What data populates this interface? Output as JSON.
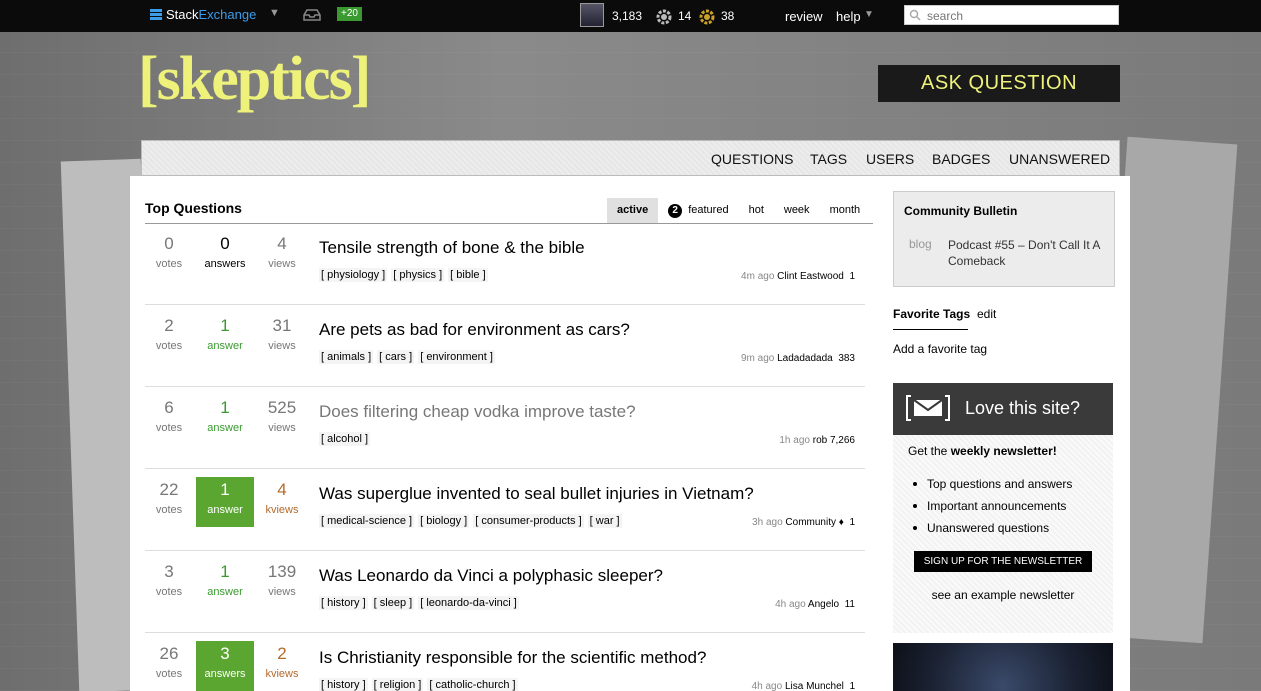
{
  "topbar": {
    "brand_part1": "Stack",
    "brand_part2": "Exchange",
    "rep_change": "+20",
    "reputation": "3,183",
    "silver_badges": "14",
    "bronze_badges": "38",
    "review": "review",
    "help": "help",
    "search_placeholder": "search"
  },
  "header": {
    "logo": "[skeptics]",
    "ask_button": "ASK QUESTION"
  },
  "nav": [
    "QUESTIONS",
    "TAGS",
    "USERS",
    "BADGES",
    "UNANSWERED"
  ],
  "main": {
    "title": "Top Questions",
    "tabs": [
      {
        "label": "active"
      },
      {
        "label": "featured",
        "count": "2"
      },
      {
        "label": "hot"
      },
      {
        "label": "week"
      },
      {
        "label": "month"
      }
    ],
    "questions": [
      {
        "votes": "0",
        "votes_label": "votes",
        "answers": "0",
        "answers_label": "answers",
        "views": "4",
        "views_label": "views",
        "title": "Tensile strength of bone & the bible",
        "tags": [
          "physiology",
          "physics",
          "bible"
        ],
        "ago": "4m ago",
        "user": "Clint Eastwood",
        "rep": "1"
      },
      {
        "votes": "2",
        "votes_label": "votes",
        "answers": "1",
        "answers_label": "answer",
        "views": "31",
        "views_label": "views",
        "title": "Are pets as bad for environment as cars?",
        "tags": [
          "animals",
          "cars",
          "environment"
        ],
        "ago": "9m ago",
        "user": "Ladadadada",
        "rep": "383"
      },
      {
        "votes": "6",
        "votes_label": "votes",
        "answers": "1",
        "answers_label": "answer",
        "views": "525",
        "views_label": "views",
        "title": "Does filtering cheap vodka improve taste?",
        "tags": [
          "alcohol"
        ],
        "ago": "1h ago",
        "user": "rob",
        "rep": "7,266"
      },
      {
        "votes": "22",
        "votes_label": "votes",
        "answers": "1",
        "answers_label": "answer",
        "views": "4",
        "views_label": "kviews",
        "title": "Was superglue invented to seal bullet injuries in Vietnam?",
        "tags": [
          "medical-science",
          "biology",
          "consumer-products",
          "war"
        ],
        "ago": "3h ago",
        "user": "Community ♦",
        "rep": "1"
      },
      {
        "votes": "3",
        "votes_label": "votes",
        "answers": "1",
        "answers_label": "answer",
        "views": "139",
        "views_label": "views",
        "title": "Was Leonardo da Vinci a polyphasic sleeper?",
        "tags": [
          "history",
          "sleep",
          "leonardo-da-vinci"
        ],
        "ago": "4h ago",
        "user": "Angelo",
        "rep": "11"
      },
      {
        "votes": "26",
        "votes_label": "votes",
        "answers": "3",
        "answers_label": "answers",
        "views": "2",
        "views_label": "kviews",
        "title": "Is Christianity responsible for the scientific method?",
        "tags": [
          "history",
          "religion",
          "catholic-church"
        ],
        "ago": "4h ago",
        "user": "Lisa Munchel",
        "rep": "1"
      }
    ]
  },
  "sidebar": {
    "bulletin_title": "Community Bulletin",
    "bulletin_kind": "blog",
    "bulletin_link": "Podcast #55 – Don't Call It A Comeback",
    "fav_title": "Favorite Tags",
    "fav_edit": "edit",
    "fav_add": "Add a favorite tag",
    "newsletter_title": "Love this site?",
    "newsletter_get": "Get the ",
    "newsletter_get_bold": "weekly newsletter!",
    "newsletter_items": [
      "Top questions and answers",
      "Important announcements",
      "Unanswered questions"
    ],
    "newsletter_button": "SIGN UP FOR THE NEWSLETTER",
    "newsletter_example": "see an example newsletter"
  }
}
